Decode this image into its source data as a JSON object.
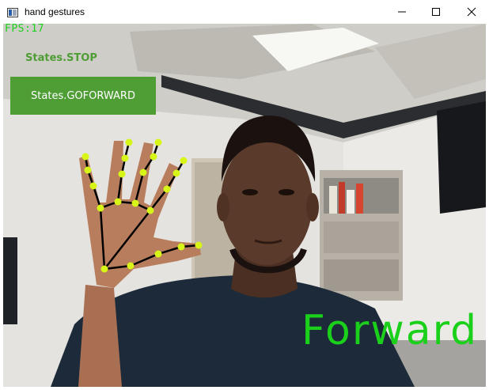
{
  "window": {
    "title": "hand gestures",
    "controls": [
      "minimize",
      "maximize",
      "close"
    ]
  },
  "overlay": {
    "fps": "FPS:17",
    "previous_state": "States.STOP",
    "current_state": "States.GOFORWARD",
    "gesture": "Forward"
  },
  "colors": {
    "overlay_green": "#1bd01b",
    "state_green": "#4e9d35",
    "landmark_dot": "#d7f516",
    "landmark_line": "#000000"
  },
  "icons": {
    "app": "app-window-icon",
    "minimize": "minimize-icon",
    "maximize": "maximize-icon",
    "close": "close-icon"
  }
}
